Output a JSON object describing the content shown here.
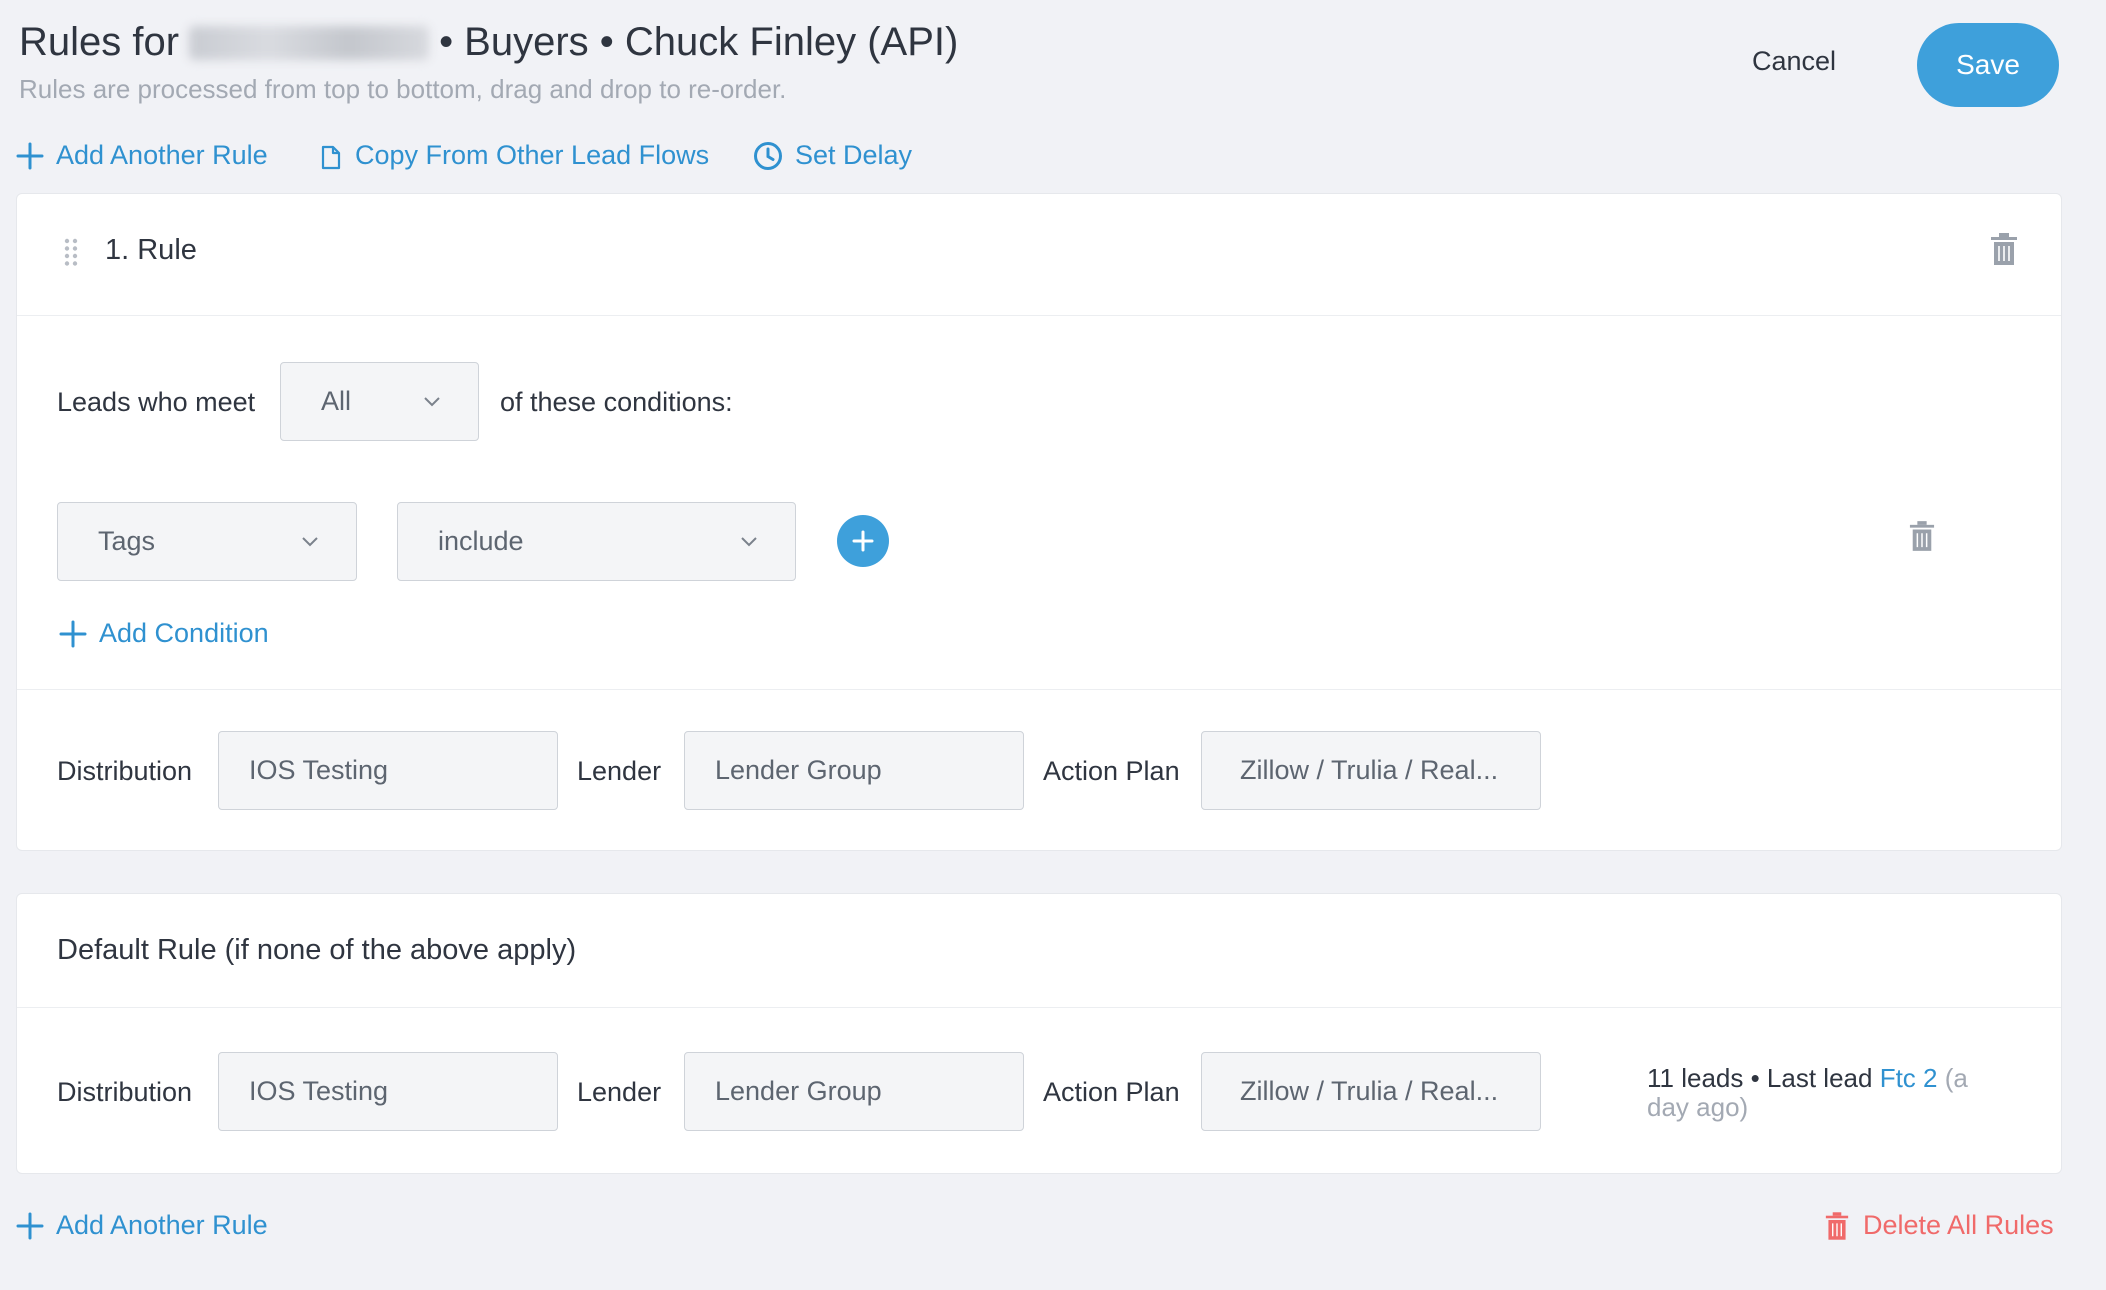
{
  "header": {
    "title_prefix": "Rules for",
    "title_suffix": "• Buyers • Chuck Finley (API)",
    "subtitle": "Rules are processed from top to bottom, drag and drop to re-order.",
    "cancel_label": "Cancel",
    "save_label": "Save"
  },
  "toolbar": {
    "add_rule_label": "Add Another Rule",
    "copy_label": "Copy From Other Lead Flows",
    "delay_label": "Set Delay"
  },
  "rule1": {
    "title": "1. Rule",
    "leads_meet_label": "Leads who meet",
    "match_value": "All",
    "conditions_suffix": "of these conditions:",
    "condition": {
      "field": "Tags",
      "operator": "include"
    },
    "add_condition_label": "Add Condition",
    "distribution_label": "Distribution",
    "distribution_value": "IOS Testing",
    "lender_label": "Lender",
    "lender_value": "Lender Group",
    "action_plan_label": "Action Plan",
    "action_plan_value": "Zillow / Trulia / Real..."
  },
  "default_rule": {
    "title": "Default Rule (if none of the above apply)",
    "distribution_label": "Distribution",
    "distribution_value": "IOS Testing",
    "lender_label": "Lender",
    "lender_value": "Lender Group",
    "action_plan_label": "Action Plan",
    "action_plan_value": "Zillow / Trulia / Real...",
    "stats_leads": "11 leads • Last lead",
    "stats_lead_name": "Ftc 2",
    "stats_time": "(a day ago)"
  },
  "footer": {
    "add_rule_label": "Add Another Rule",
    "delete_all_label": "Delete All Rules"
  },
  "colors": {
    "accent": "#3ea0db",
    "link": "#2f91d0",
    "danger": "#f06a6a",
    "background": "#f1f2f6"
  }
}
